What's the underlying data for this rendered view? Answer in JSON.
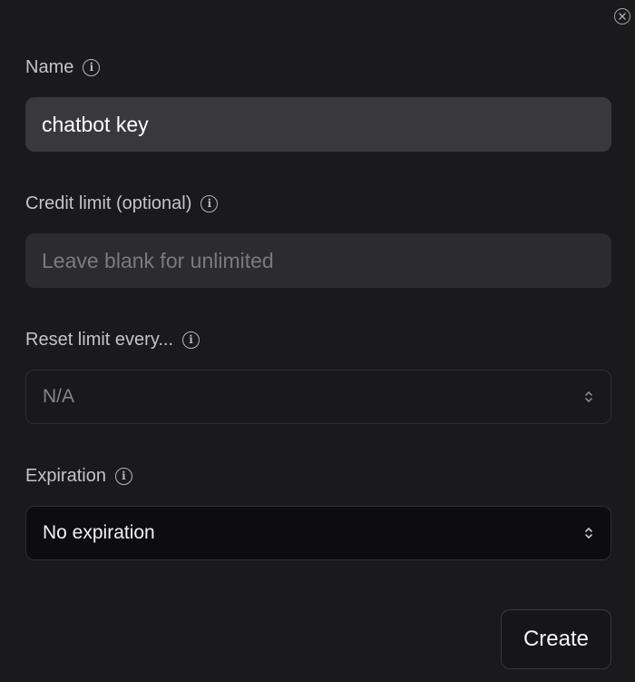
{
  "dialog": {
    "close_icon": "close-circle-icon",
    "fields": {
      "name": {
        "label": "Name",
        "value": "chatbot key",
        "info_icon": "info-icon"
      },
      "credit_limit": {
        "label": "Credit limit (optional)",
        "value": "",
        "placeholder": "Leave blank for unlimited",
        "info_icon": "info-icon"
      },
      "reset_limit": {
        "label": "Reset limit every...",
        "value": "N/A",
        "disabled": true,
        "info_icon": "info-icon"
      },
      "expiration": {
        "label": "Expiration",
        "value": "No expiration",
        "info_icon": "info-icon"
      }
    },
    "create_label": "Create"
  }
}
